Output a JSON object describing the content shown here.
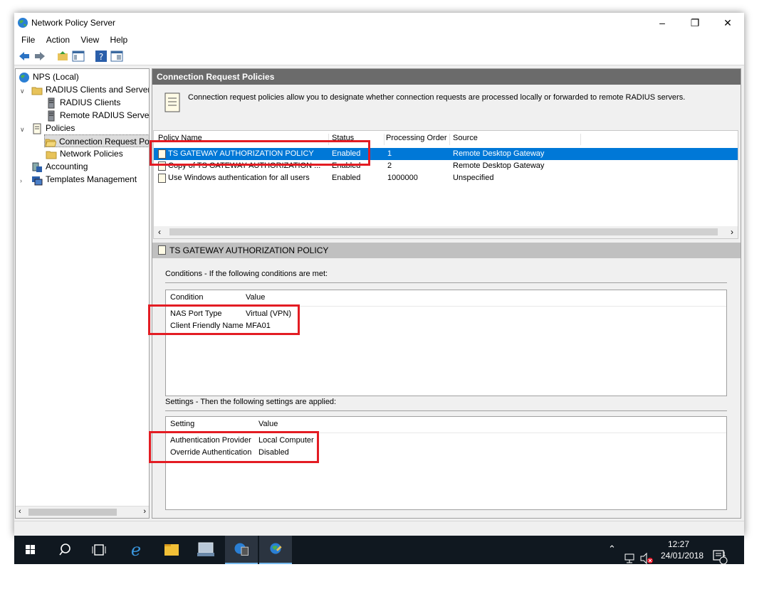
{
  "window": {
    "title": "Network Policy Server"
  },
  "menu": [
    "File",
    "Action",
    "View",
    "Help"
  ],
  "tree": {
    "root": "NPS (Local)",
    "radius_group": "RADIUS Clients and Servers",
    "radius_clients": "RADIUS Clients",
    "remote_radius": "Remote RADIUS Server",
    "policies": "Policies",
    "crp": "Connection Request Po",
    "network_policies": "Network Policies",
    "accounting": "Accounting",
    "templates": "Templates Management"
  },
  "pane": {
    "header": "Connection Request Policies",
    "description": "Connection request policies allow you to designate whether connection requests are processed locally or forwarded to remote RADIUS servers."
  },
  "policy_list": {
    "columns": [
      "Policy Name",
      "Status",
      "Processing Order",
      "Source"
    ],
    "rows": [
      {
        "name": "TS GATEWAY AUTHORIZATION POLICY",
        "status": "Enabled",
        "order": "1",
        "source": "Remote Desktop Gateway"
      },
      {
        "name": "Copy of TS GATEWAY AUTHORIZATION ...",
        "status": "Enabled",
        "order": "2",
        "source": "Remote Desktop Gateway"
      },
      {
        "name": "Use Windows authentication for all users",
        "status": "Enabled",
        "order": "1000000",
        "source": "Unspecified"
      }
    ]
  },
  "detail": {
    "title": "TS GATEWAY AUTHORIZATION POLICY",
    "conditions_label": "Conditions - If the following conditions are met:",
    "conditions_columns": [
      "Condition",
      "Value"
    ],
    "conditions": [
      {
        "name": "NAS Port Type",
        "value": "Virtual (VPN)"
      },
      {
        "name": "Client Friendly Name",
        "value": "MFA01"
      }
    ],
    "settings_label": "Settings - Then the following settings are applied:",
    "settings_columns": [
      "Setting",
      "Value"
    ],
    "settings": [
      {
        "name": "Authentication Provider",
        "value": "Local Computer"
      },
      {
        "name": "Override Authentication",
        "value": "Disabled"
      }
    ]
  },
  "taskbar": {
    "time": "12:27",
    "date": "24/01/2018",
    "notification_count": "1"
  },
  "colors": {
    "selection": "#0078d7",
    "highlight_box": "#e31c23",
    "header_bar": "#6b6b6b"
  },
  "icons": [
    "globe-icon",
    "folder-icon",
    "server-icon",
    "policy-icon",
    "back-icon",
    "forward-icon",
    "help-icon",
    "windows-start-icon",
    "search-icon",
    "task-view-icon",
    "edge-icon",
    "file-explorer-icon"
  ]
}
